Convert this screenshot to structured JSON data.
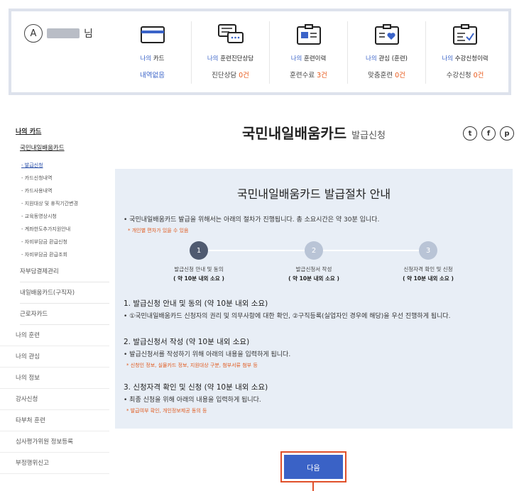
{
  "user": {
    "avatar_glyph": "A",
    "suffix": "님"
  },
  "stats": [
    {
      "label_prefix": "나의",
      "label_rest": " 카드",
      "value": "내역없음",
      "value_count": ""
    },
    {
      "label_prefix": "나의",
      "label_rest": " 훈련진단상담",
      "value": "진단상담 ",
      "value_count": "0건"
    },
    {
      "label_prefix": "나의",
      "label_rest": " 훈련이력",
      "value": "훈련수료 ",
      "value_count": "3건"
    },
    {
      "label_prefix": "나의",
      "label_rest": " 관심 (훈련)",
      "value": "맞춤훈련 ",
      "value_count": "0건"
    },
    {
      "label_prefix": "나의",
      "label_rest": " 수강신청이력",
      "value": "수강신청 ",
      "value_count": "0건"
    }
  ],
  "sidebar": {
    "head": "나의 카드",
    "sub": "국민내일배움카드",
    "items": [
      "- 발급신청",
      "- 카드신청내역",
      "- 카드사용내역",
      "- 지원대상 및 휴직기간변경",
      "- 교육동영상시청",
      "- 계좌한도추가지원안내",
      "- 자비부담금 환급신청",
      "- 자비부담금 환급조회"
    ],
    "second_items": [
      "자부담결제관리",
      "내일배움카드(구직자)",
      "근로자카드"
    ],
    "main_items": [
      "나의 훈련",
      "나의 관심",
      "나의 정보",
      "강사신청",
      "타부처 훈련",
      "심사평가위원 정보등록",
      "부정행위신고"
    ]
  },
  "page": {
    "title": "국민내일배움카드",
    "title_sub": "발급신청"
  },
  "social": [
    "t",
    "f",
    "p"
  ],
  "panel": {
    "title": "국민내일배움카드 발급절차 안내",
    "intro": "• 국민내일배움카드 발급을 위해서는 아래의 절차가 진행됩니다. 총 소요시간은 약 30분 입니다.",
    "intro_note": "* 개인별 편차가 있을 수 있음",
    "steps": [
      {
        "num": "1",
        "label": "발급신청 안내 및 동의",
        "time": "( 약 10분 내외 소요 )"
      },
      {
        "num": "2",
        "label": "발급신청서 작성",
        "time": "( 약 10분 내외 소요 )"
      },
      {
        "num": "3",
        "label": "신청자격 확인 및 신청",
        "time": "( 약 10분 내외 소요 )"
      }
    ],
    "sections": [
      {
        "title": "1. 발급신청 안내 및 동의 (약 10분 내외 소요)",
        "text": "• ①국민내일배움카드 신청자의 권리 및 의무사항에 대한 확인, ②구직등록(실업자인 경우에 해당)을 우선 진행하게 됩니다.",
        "note": ""
      },
      {
        "title": "2. 발급신청서 작성 (약 10분 내외 소요)",
        "text": "• 발급신청서를 작성하기 위해 아래의 내용을 입력하게 됩니다.",
        "note": "* 신청인 정보, 실물카드 정보, 지원대상 구분, 첨부서류 첨부 등"
      },
      {
        "title": "3. 신청자격 확인 및 신청 (약 10분 내외 소요)",
        "text": "• 최종 신청을 위해 아래의 내용을 입력하게 됩니다.",
        "note": "* 발급여부 확인, 개인정보제공 동의 등"
      }
    ]
  },
  "next_button": "다음"
}
